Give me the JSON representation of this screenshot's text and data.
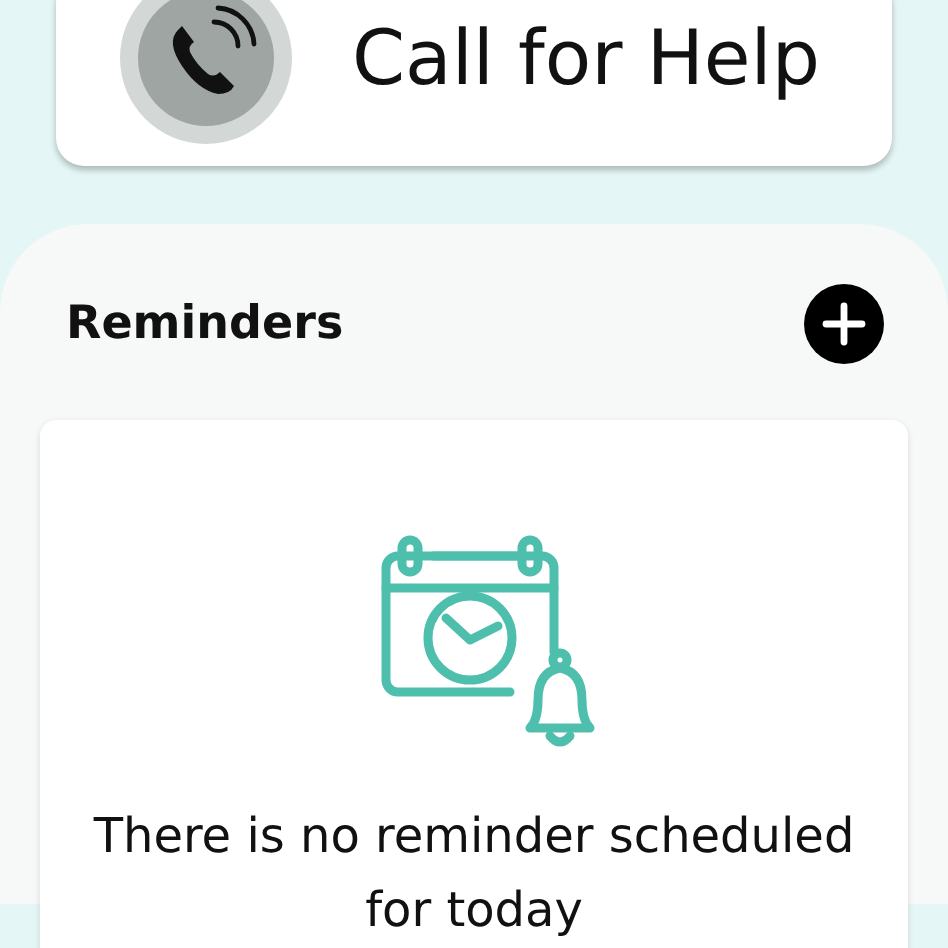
{
  "help_card": {
    "label": "Call for Help"
  },
  "reminders": {
    "title": "Reminders",
    "empty_message": "There is no reminder scheduled for today"
  }
}
